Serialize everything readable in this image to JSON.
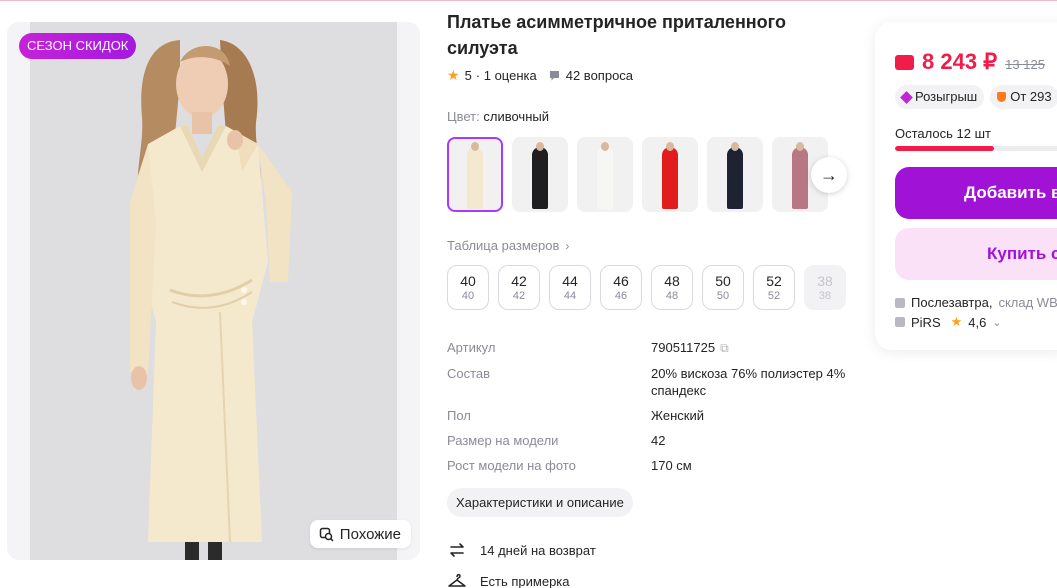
{
  "gallery": {
    "badge": "СЕЗОН СКИДОК",
    "similar_label": "Похожие"
  },
  "product": {
    "title": "Платье асимметричное приталенного силуэта",
    "rating": "5",
    "reviews": "· 1 оценка",
    "questions": "42 вопроса"
  },
  "color": {
    "label": "Цвет:",
    "value": "сливочный",
    "swatch_colors": [
      "#f4e8cf",
      "#1f1f22",
      "#f6f6f4",
      "#e21c1c",
      "#1e2233",
      "#b97683"
    ]
  },
  "sizes": {
    "table_label": "Таблица размеров",
    "items": [
      {
        "ru": "40",
        "alt": "40",
        "available": true
      },
      {
        "ru": "42",
        "alt": "42",
        "available": true
      },
      {
        "ru": "44",
        "alt": "44",
        "available": true
      },
      {
        "ru": "46",
        "alt": "46",
        "available": true
      },
      {
        "ru": "48",
        "alt": "48",
        "available": true
      },
      {
        "ru": "50",
        "alt": "50",
        "available": true
      },
      {
        "ru": "52",
        "alt": "52",
        "available": true
      },
      {
        "ru": "38",
        "alt": "38",
        "available": false
      }
    ]
  },
  "specs": [
    {
      "key": "Артикул",
      "value": "790511725"
    },
    {
      "key": "Состав",
      "value": "20% вискоза 76% полиэстер 4% спандекс"
    },
    {
      "key": "Пол",
      "value": "Женский"
    },
    {
      "key": "Размер на модели",
      "value": "42"
    },
    {
      "key": "Рост модели на фото",
      "value": "170 см"
    }
  ],
  "characteristics_button": "Характеристики и описание",
  "features": [
    {
      "text": "14 дней на возврат",
      "icon": "return-icon"
    },
    {
      "text": "Есть примерка",
      "icon": "hanger-icon"
    }
  ],
  "buy": {
    "price": "8 243 ₽",
    "old_price": "13 125",
    "chip_raffle": "Розыгрыш",
    "chip_from": "От 293",
    "stock": "Осталось 12 шт",
    "stock_fraction": 0.55,
    "add_button": "Добавить в",
    "buy_button": "Купить с",
    "delivery": "Послезавтра,",
    "warehouse": "склад WB",
    "seller": "PiRS",
    "seller_rating": "4,6",
    "accent": "#a013d6",
    "price_color": "#f01d4b"
  }
}
